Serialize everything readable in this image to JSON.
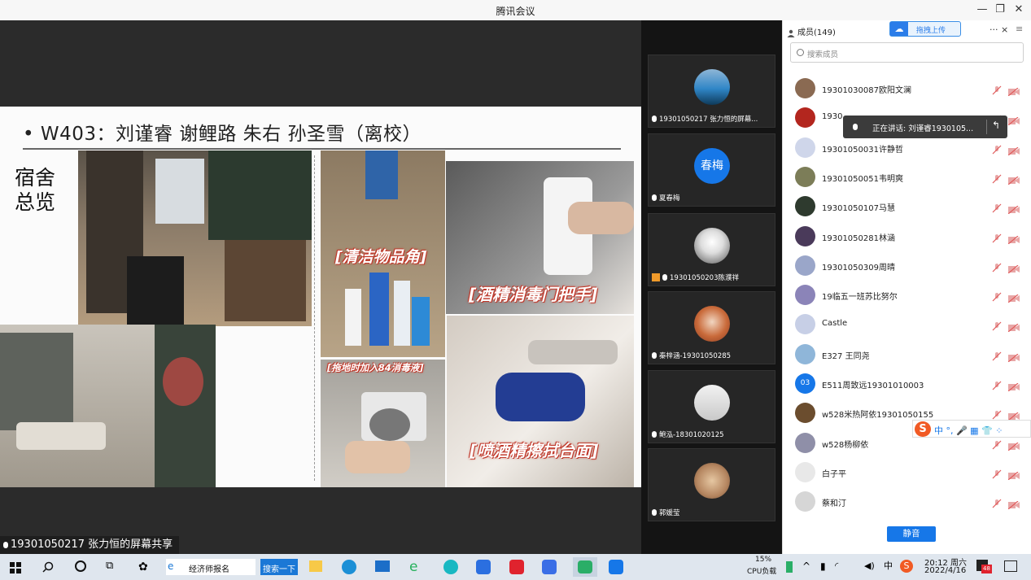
{
  "window": {
    "title": "腾讯会议"
  },
  "slide": {
    "heading": "• W403：刘谨睿 谢鲤路 朱右 孙圣雪（离校）",
    "side_title_line1": "宿舍",
    "side_title_line2": "总览",
    "captions": [
      "[清洁物品角]",
      "[酒精消毒门把手]",
      "[拖地时加入84消毒液]",
      "[喷酒精擦拭台面]"
    ]
  },
  "share_label": "19301050217 张力恒的屏幕共享",
  "video_tiles": [
    {
      "name": "19301050217 张力恒的屏幕..."
    },
    {
      "name": "夏春梅",
      "avatar_text": "春梅"
    },
    {
      "name": "19301050203陈濮祥"
    },
    {
      "name": "秦梓涵-19301050285"
    },
    {
      "name": "鲍泓-18301020125"
    },
    {
      "name": "郭媛莹"
    }
  ],
  "panel": {
    "members_title": "成员(149)",
    "upload_label": "拖拽上传",
    "more_close": "··· ×",
    "search_placeholder": "搜索成员",
    "speaking_tooltip": "正在讲话: 刘谨睿1930105...",
    "mute_all_label": "静音",
    "members": [
      {
        "name": "19301030087欧阳文澜",
        "avatar_color": "#8a6a52"
      },
      {
        "name": "1930",
        "avatar_color": "#b3261e"
      },
      {
        "name": "19301050031许静哲",
        "avatar_color": "#cfd6ea"
      },
      {
        "name": "19301050051韦明爽",
        "avatar_color": "#7c7d58"
      },
      {
        "name": "19301050107马慧",
        "avatar_color": "#2e3a2e"
      },
      {
        "name": "19301050281林涵",
        "avatar_color": "#4a3a5a"
      },
      {
        "name": "19301050309周晴",
        "avatar_color": "#9aa6c9"
      },
      {
        "name": "19临五一班苏比努尔",
        "avatar_color": "#8b84b8"
      },
      {
        "name": "Castle",
        "avatar_color": "#c7cfe6"
      },
      {
        "name": "E327 王同尧",
        "avatar_color": "#8fb6d9"
      },
      {
        "name": "E511周致远19301010003",
        "avatar_color": "#1677e8",
        "avatar_text": "03"
      },
      {
        "name": "w528米热阿依19301050155",
        "avatar_color": "#6b4d2e"
      },
      {
        "name": "w528杨柳依",
        "avatar_color": "#8f8fa8"
      },
      {
        "name": "白子平",
        "avatar_color": "#e8e8e8"
      },
      {
        "name": "蔡和汀",
        "avatar_color": "#d6d6d6"
      }
    ]
  },
  "ime_bar": {
    "label": "中 °, 🎤 ▦ 👕 ⁘"
  },
  "taskbar": {
    "search_text": "经济师报名",
    "search_button": "搜索一下",
    "cpu_percent": "15%",
    "cpu_label": "CPU负载",
    "time": "20:12 周六",
    "date": "2022/4/16",
    "notif_count": "48"
  }
}
